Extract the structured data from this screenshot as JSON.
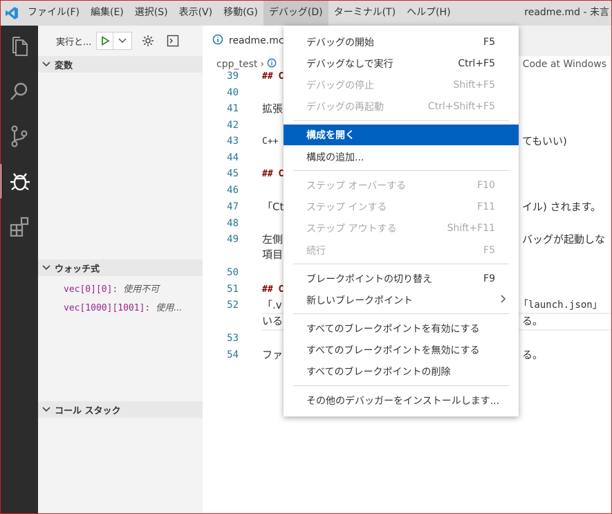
{
  "titlebar": {
    "menu": [
      "ファイル(F)",
      "編集(E)",
      "選択(S)",
      "表示(V)",
      "移動(G)",
      "デバッグ(D)",
      "ターミナル(T)",
      "ヘルプ(H)"
    ],
    "window_title": "readme.md - 未言",
    "active_menu": "デバッグ(D)"
  },
  "activitybar": {
    "icons": [
      "files-icon",
      "search-icon",
      "source-control-icon",
      "debug-icon",
      "extensions-icon"
    ]
  },
  "sidebar": {
    "run_label": "実行と...",
    "sections": {
      "variables": "変数",
      "watch": "ウォッチ式",
      "callstack": "コール スタック"
    },
    "watch_items": [
      {
        "expr": "vec[0][0]:",
        "value": "使用不可"
      },
      {
        "expr": "vec[1000][1001]:",
        "value": "使用..."
      }
    ]
  },
  "editor": {
    "tab_label": "readme.mc",
    "breadcrumb_root": "cpp_test",
    "breadcrumb_sep": "›",
    "breadcrumb_right": "Code at Windows",
    "lines": [
      {
        "n": "39",
        "text": "## C",
        "style": "heading"
      },
      {
        "n": "40",
        "text": "",
        "style": ""
      },
      {
        "n": "41",
        "text": "拡張",
        "style": ""
      },
      {
        "n": "42",
        "text": "",
        "style": ""
      },
      {
        "n": "43",
        "text": "C++",
        "style": "mono",
        "right": "てもいい)"
      },
      {
        "n": "44",
        "text": "",
        "style": ""
      },
      {
        "n": "45",
        "text": "## C",
        "style": "heading"
      },
      {
        "n": "46",
        "text": "",
        "style": ""
      },
      {
        "n": "47",
        "text": "「Ct",
        "style": "",
        "right": "イル) されます。"
      },
      {
        "n": "48",
        "text": "",
        "style": ""
      },
      {
        "n": "49",
        "text": "左側",
        "style": "",
        "right": "バッグが起動しな"
      },
      {
        "n": "",
        "text": "項目",
        "style": ""
      },
      {
        "n": "50",
        "text": "",
        "style": ""
      },
      {
        "n": "51",
        "text": "## C",
        "style": "heading"
      },
      {
        "n": "52",
        "text": "「.v",
        "style": "",
        "right": "「launch.json」"
      },
      {
        "n": "",
        "text": "いる",
        "style": "",
        "right": "る。"
      },
      {
        "n": "53",
        "text": "",
        "style": ""
      },
      {
        "n": "54",
        "text": "ファ",
        "style": "",
        "right": "る。"
      }
    ]
  },
  "debug_menu": {
    "items": [
      {
        "label": "デバッグの開始",
        "key": "F5",
        "state": "normal"
      },
      {
        "label": "デバッグなしで実行",
        "key": "Ctrl+F5",
        "state": "normal"
      },
      {
        "label": "デバッグの停止",
        "key": "Shift+F5",
        "state": "disabled"
      },
      {
        "label": "デバッグの再起動",
        "key": "Ctrl+Shift+F5",
        "state": "disabled"
      },
      {
        "label": "構成を開く",
        "key": "",
        "state": "highlight"
      },
      {
        "label": "構成の追加...",
        "key": "",
        "state": "normal"
      },
      {
        "label": "ステップ オーバーする",
        "key": "F10",
        "state": "disabled"
      },
      {
        "label": "ステップ インする",
        "key": "F11",
        "state": "disabled"
      },
      {
        "label": "ステップ アウトする",
        "key": "Shift+F11",
        "state": "disabled"
      },
      {
        "label": "続行",
        "key": "F5",
        "state": "disabled"
      },
      {
        "label": "ブレークポイントの切り替え",
        "key": "F9",
        "state": "normal"
      },
      {
        "label": "新しいブレークポイント",
        "key": "",
        "state": "submenu"
      },
      {
        "label": "すべてのブレークポイントを有効にする",
        "key": "",
        "state": "normal"
      },
      {
        "label": "すべてのブレークポイントを無効にする",
        "key": "",
        "state": "normal"
      },
      {
        "label": "すべてのブレークポイントの削除",
        "key": "",
        "state": "normal"
      },
      {
        "label": "その他のデバッガーをインストールします...",
        "key": "",
        "state": "normal"
      }
    ]
  },
  "colors": {
    "accent": "#0060c0",
    "activitybar": "#2c2c2c",
    "line_number": "#237893",
    "watch_expr": "#9b2393"
  }
}
